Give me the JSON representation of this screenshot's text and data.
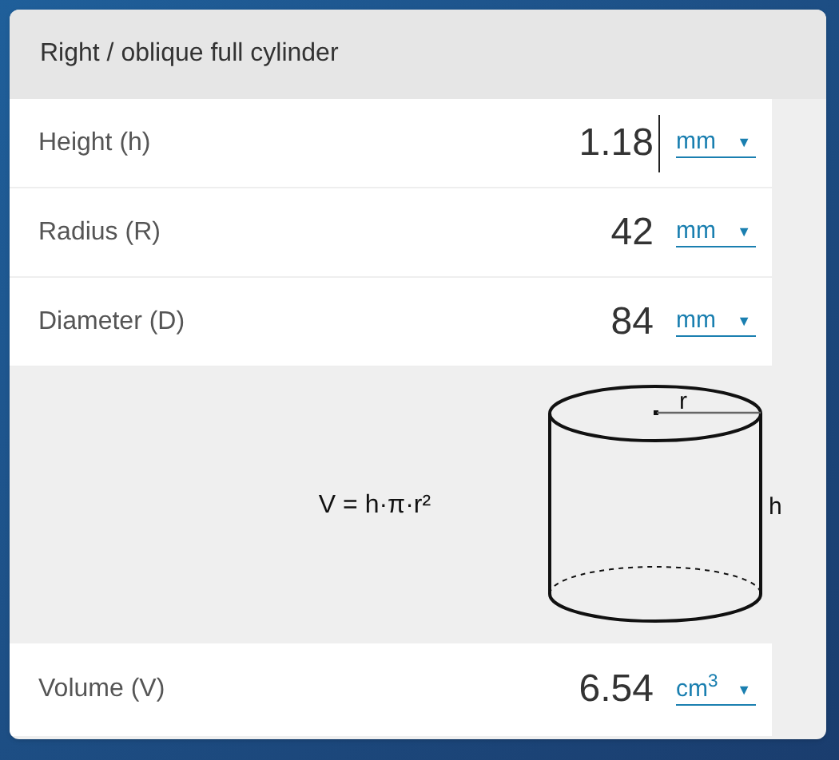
{
  "panel": {
    "title": "Right / oblique full cylinder"
  },
  "inputs": [
    {
      "label": "Height (h)",
      "value": "1.18",
      "unit": "mm",
      "caret": "▼",
      "focused": true
    },
    {
      "label": "Radius (R)",
      "value": "42",
      "unit": "mm",
      "caret": "▼",
      "focused": false
    },
    {
      "label": "Diameter (D)",
      "value": "84",
      "unit": "mm",
      "caret": "▼",
      "focused": false
    }
  ],
  "diagram": {
    "formula": "V = h·π·r²",
    "radius_label": "r",
    "height_label": "h"
  },
  "result": {
    "label": "Volume (V)",
    "value": "6.54",
    "unit": "cm$^{3}$",
    "caret": "▼"
  }
}
